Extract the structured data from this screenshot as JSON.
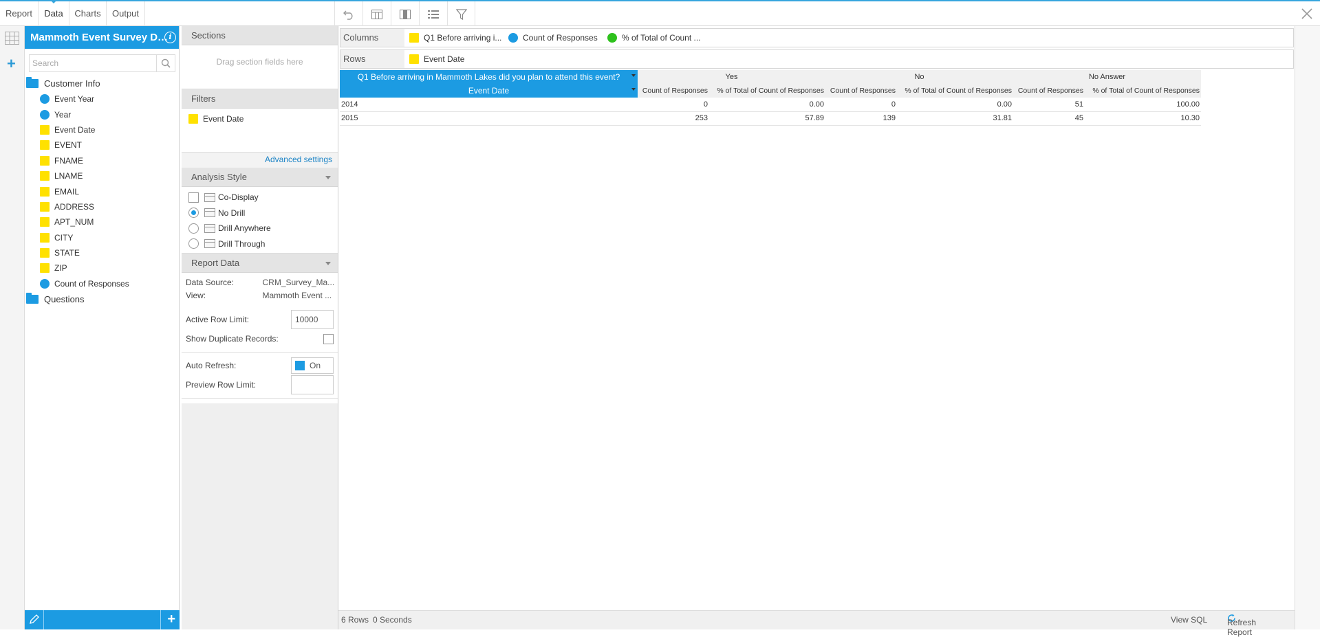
{
  "topbar": {
    "tabs": [
      "Report",
      "Data",
      "Charts",
      "Output"
    ],
    "active_tab": "Data"
  },
  "fields_panel": {
    "title": "Mammoth Event Survey D…",
    "search_placeholder": "Search",
    "folders": [
      {
        "label": "Customer Info",
        "fields": [
          {
            "label": "Event Year",
            "kind": "metric"
          },
          {
            "label": "Year",
            "kind": "metric"
          },
          {
            "label": "Event Date",
            "kind": "dimension"
          },
          {
            "label": "EVENT",
            "kind": "dimension"
          },
          {
            "label": "FNAME",
            "kind": "dimension"
          },
          {
            "label": "LNAME",
            "kind": "dimension"
          },
          {
            "label": "EMAIL",
            "kind": "dimension"
          },
          {
            "label": "ADDRESS",
            "kind": "dimension"
          },
          {
            "label": "APT_NUM",
            "kind": "dimension"
          },
          {
            "label": "CITY",
            "kind": "dimension"
          },
          {
            "label": "STATE",
            "kind": "dimension"
          },
          {
            "label": "ZIP",
            "kind": "dimension"
          },
          {
            "label": "Count of Responses",
            "kind": "metric"
          }
        ]
      },
      {
        "label": "Questions",
        "fields": []
      }
    ]
  },
  "settings": {
    "sections_title": "Sections",
    "sections_drop": "Drag section fields here",
    "filters_title": "Filters",
    "filter_item": "Event Date",
    "advanced_settings": "Advanced settings",
    "analysis_style_title": "Analysis Style",
    "co_display": "Co-Display",
    "styles": [
      "No Drill",
      "Drill Anywhere",
      "Drill Through"
    ],
    "selected_style": "No Drill",
    "report_data_title": "Report Data",
    "data_source_label": "Data Source:",
    "data_source_value": "CRM_Survey_Ma...",
    "view_label": "View:",
    "view_value": "Mammoth Event ...",
    "active_row_limit_label": "Active Row Limit:",
    "active_row_limit_value": "10000",
    "show_duplicates_label": "Show Duplicate Records:",
    "auto_refresh_label": "Auto Refresh:",
    "auto_refresh_value": "On",
    "preview_row_limit_label": "Preview Row Limit:",
    "preview_row_limit_value": ""
  },
  "shelves": {
    "columns_label": "Columns",
    "columns_chips": [
      "Q1 Before arriving i...",
      "Count of Responses",
      "% of Total of Count ..."
    ],
    "rows_label": "Rows",
    "rows_chips": [
      "Event Date"
    ]
  },
  "table": {
    "question_header": "Q1 Before arriving in Mammoth Lakes did you plan to attend this event?",
    "row_header": "Event Date",
    "groups": [
      "Yes",
      "No",
      "No Answer"
    ],
    "sub_headers": [
      "Count of Responses",
      "% of Total of Count of Responses"
    ],
    "rows": [
      {
        "label": "2014",
        "values": [
          "0",
          "0.00",
          "0",
          "0.00",
          "51",
          "100.00"
        ]
      },
      {
        "label": "2015",
        "values": [
          "253",
          "57.89",
          "139",
          "31.81",
          "45",
          "10.30"
        ]
      }
    ]
  },
  "status": {
    "rows": "6 Rows",
    "time": "0 Seconds",
    "view_sql": "View SQL",
    "refresh": "Refresh Report"
  },
  "colors": {
    "accent": "#1c9be2",
    "metric": "#1c9be2",
    "dimension": "#ffe100",
    "percent": "#2ec11d"
  }
}
